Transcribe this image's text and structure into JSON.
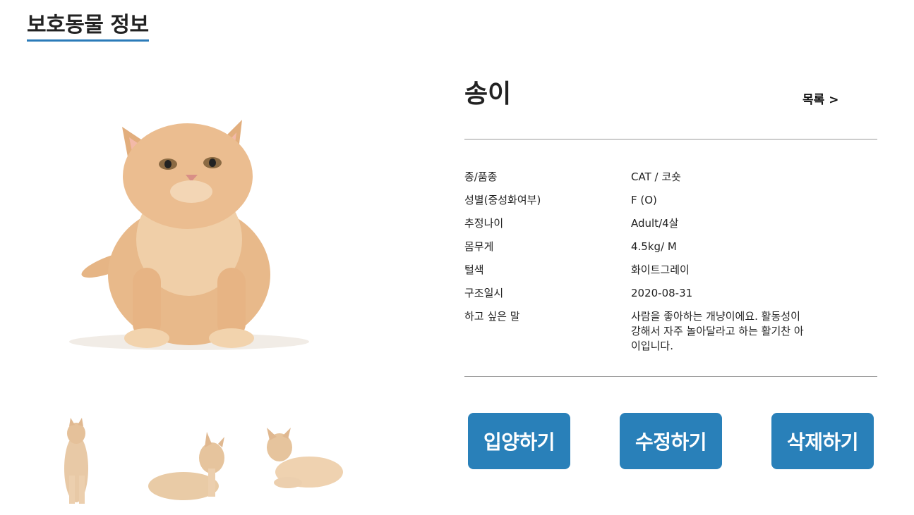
{
  "page": {
    "title": "보호동물 정보"
  },
  "pet": {
    "name": "송이",
    "list_link": "목록 >",
    "details": [
      {
        "label": "종/품종",
        "value": "CAT / 코숏"
      },
      {
        "label": "성별(중성화여부)",
        "value": "F (O)"
      },
      {
        "label": "추정나이",
        "value": "Adult/4살"
      },
      {
        "label": "몸무게",
        "value": "4.5kg/ M"
      },
      {
        "label": "털색",
        "value": "화이트그레이"
      },
      {
        "label": "구조일시",
        "value": "2020-08-31"
      },
      {
        "label": "하고 싶은 말",
        "value": "사람을 좋아하는 개냥이에요. 활동성이 강해서 자주 놀아달라고 하는 활기찬 아이입니다."
      }
    ]
  },
  "actions": {
    "adopt": "입양하기",
    "edit": "수정하기",
    "delete": "삭제하기"
  },
  "colors": {
    "accent": "#2980b9",
    "underline": "#2b7bb9",
    "divider": "#999999",
    "fur": "#e8b98a"
  },
  "images": {
    "main": "cat-photo",
    "thumbnails": [
      "cat-sitting-thumbnail",
      "cat-lying-thumbnail",
      "cat-reclining-thumbnail"
    ]
  }
}
